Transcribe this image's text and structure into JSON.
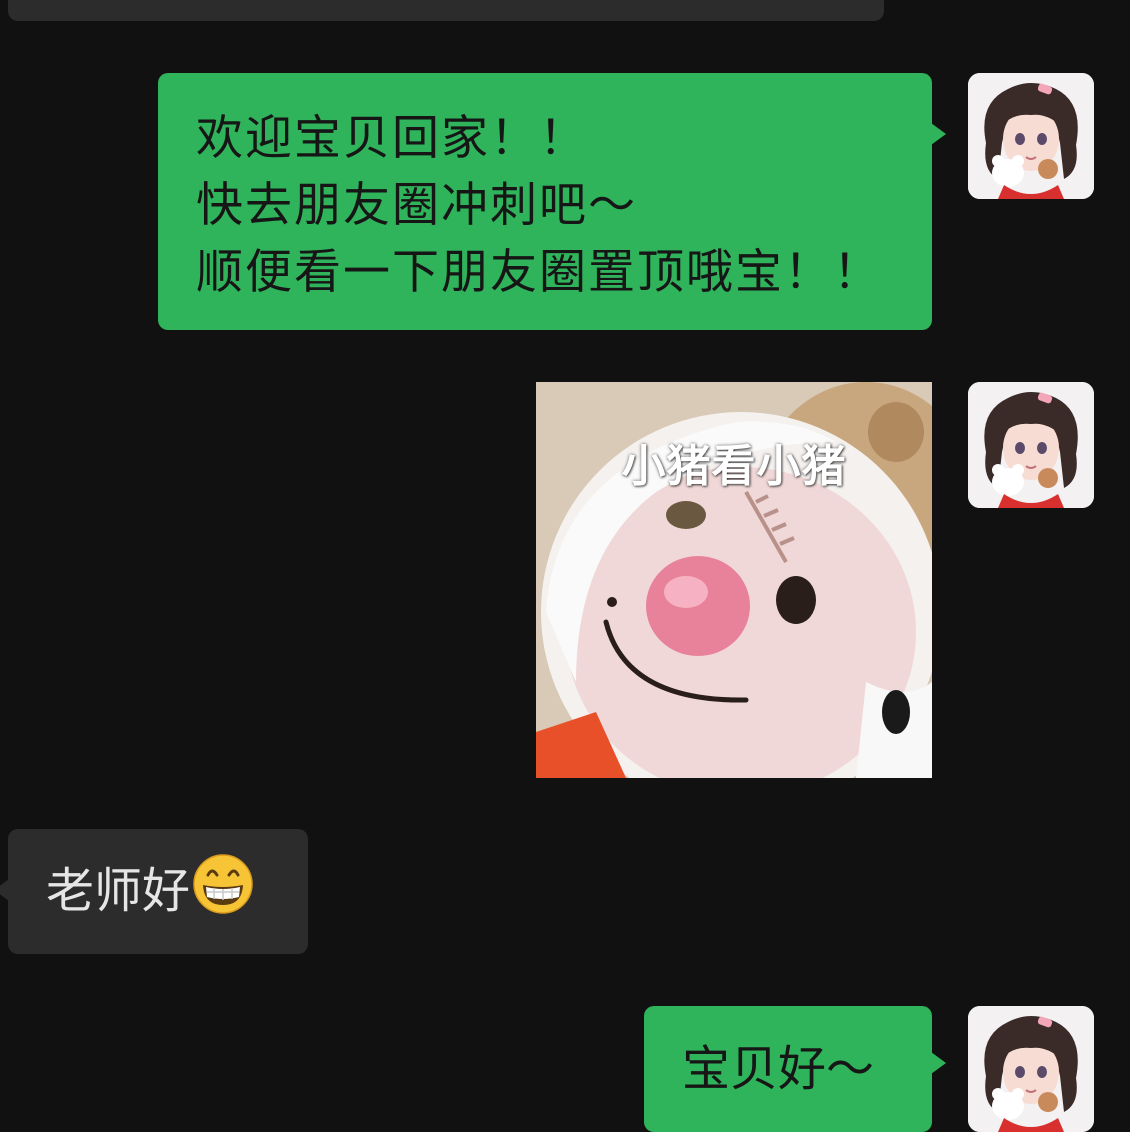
{
  "chat": {
    "messages": [
      {
        "sender": "me",
        "type": "text",
        "lines": [
          "欢迎宝贝回家！！",
          "快去朋友圈冲刺吧～",
          "顺便看一下朋友圈置顶哦宝！！"
        ]
      },
      {
        "sender": "me",
        "type": "sticker",
        "caption": "小猪看小猪"
      },
      {
        "sender": "other",
        "type": "text",
        "text": "老师好",
        "emoji": "grinning-face-emoji"
      },
      {
        "sender": "me",
        "type": "text",
        "text": "宝贝好～"
      }
    ]
  },
  "icons": {
    "avatar": "girl-avatar-icon",
    "emoji": "grinning-face-emoji"
  },
  "colors": {
    "background": "#111111",
    "my_bubble": "#2fb35b",
    "other_bubble": "#2c2c2c"
  }
}
